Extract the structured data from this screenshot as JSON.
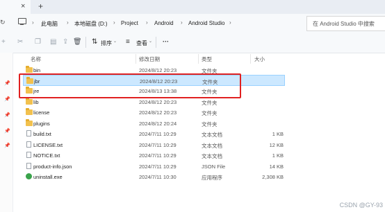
{
  "addressbar": {
    "crumbs": [
      "此电脑",
      "本地磁盘 (D:)",
      "Project",
      "Android",
      "Android Studio"
    ],
    "search_placeholder": "在 Android Studio 中搜索"
  },
  "toolbar": {
    "sort_label": "排序",
    "view_label": "查看",
    "more_label": "···"
  },
  "columns": {
    "name": "名称",
    "date": "修改日期",
    "type": "类型",
    "size": "大小"
  },
  "files": [
    {
      "name": "bin",
      "date": "2024/8/12 20:23",
      "type": "文件夹",
      "size": "",
      "kind": "folder"
    },
    {
      "name": "jbr",
      "date": "2024/8/12 20:23",
      "type": "文件夹",
      "size": "",
      "kind": "folder",
      "selected": true
    },
    {
      "name": "jre",
      "date": "2024/8/13 13:38",
      "type": "文件夹",
      "size": "",
      "kind": "folder"
    },
    {
      "name": "lib",
      "date": "2024/8/12 20:23",
      "type": "文件夹",
      "size": "",
      "kind": "folder"
    },
    {
      "name": "license",
      "date": "2024/8/12 20:23",
      "type": "文件夹",
      "size": "",
      "kind": "folder"
    },
    {
      "name": "plugins",
      "date": "2024/8/12 20:24",
      "type": "文件夹",
      "size": "",
      "kind": "folder"
    },
    {
      "name": "build.txt",
      "date": "2024/7/11 10:29",
      "type": "文本文档",
      "size": "1 KB",
      "kind": "file"
    },
    {
      "name": "LICENSE.txt",
      "date": "2024/7/11 10:29",
      "type": "文本文档",
      "size": "12 KB",
      "kind": "file"
    },
    {
      "name": "NOTICE.txt",
      "date": "2024/7/11 10:29",
      "type": "文本文档",
      "size": "1 KB",
      "kind": "file"
    },
    {
      "name": "product-info.json",
      "date": "2024/7/11 10:29",
      "type": "JSON File",
      "size": "14 KB",
      "kind": "file"
    },
    {
      "name": "uninstall.exe",
      "date": "2024/7/11 10:30",
      "type": "应用程序",
      "size": "2,308 KB",
      "kind": "exe"
    }
  ],
  "watermark": "CSDN @GY-93"
}
